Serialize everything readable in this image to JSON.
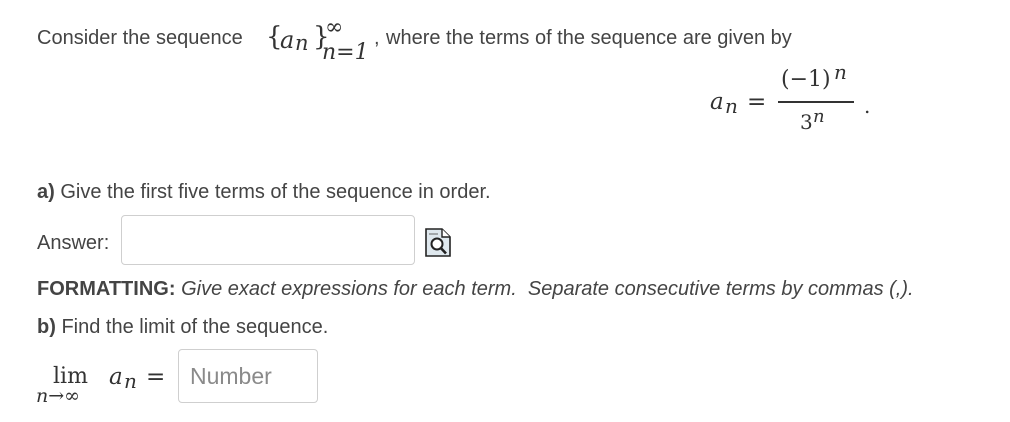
{
  "intro": {
    "prefix": "Consider the sequence",
    "seq_open_brace": "{",
    "seq_term": "a",
    "seq_term_sub": "n",
    "seq_close_brace": "}",
    "seq_upper": "∞",
    "seq_lower": "n=1",
    "comma": ",",
    "suffix": "where the terms of the sequence are given by"
  },
  "formula": {
    "lhs_var": "a",
    "lhs_sub": "n",
    "equals": "=",
    "numerator_base": "(−1)",
    "numerator_exp": "n",
    "denominator_base": "3",
    "denominator_exp": "n",
    "period": "."
  },
  "part_a": {
    "label": "a)",
    "text": "Give the first five terms of the sequence in order."
  },
  "answer": {
    "label": "Answer:",
    "value": "",
    "placeholder": ""
  },
  "formatting": {
    "label": "FORMATTING:",
    "text": "Give exact expressions for each term.  Separate consecutive terms by commas (,)."
  },
  "part_b": {
    "label": "b)",
    "text": "Find the limit of the sequence."
  },
  "limit": {
    "lim": "lim",
    "under": "n→∞",
    "var": "a",
    "sub": "n",
    "equals": "=",
    "input_value": "",
    "input_placeholder": "Number"
  },
  "icons": {
    "preview": "preview-magnifier-icon"
  }
}
